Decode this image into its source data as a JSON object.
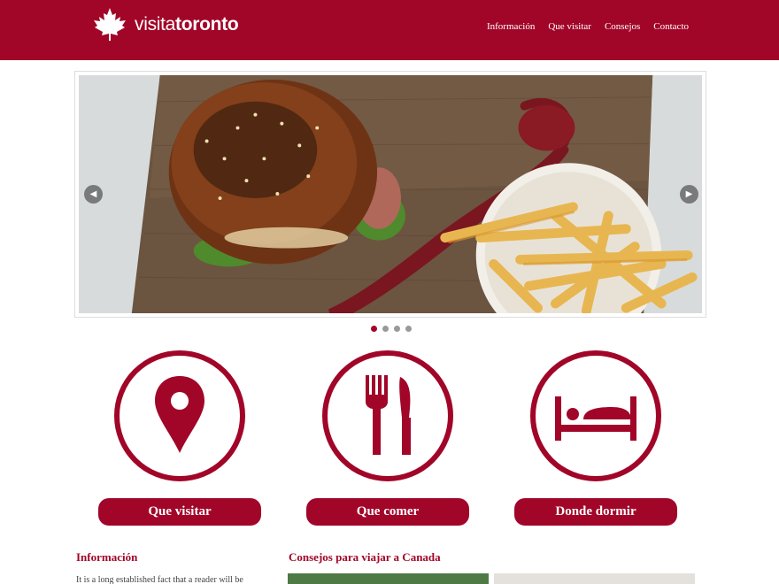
{
  "header": {
    "logo": {
      "light": "visita",
      "bold": "toronto"
    },
    "nav": [
      "Información",
      "Que visitar",
      "Consejos",
      "Contacto"
    ],
    "color": "#a10628"
  },
  "carousel": {
    "prev_icon": "chevron-left-icon",
    "next_icon": "chevron-right-icon",
    "slides": 4,
    "active_slide": 1
  },
  "features": [
    {
      "label": "Que visitar",
      "icon": "map-pin-icon"
    },
    {
      "label": "Que comer",
      "icon": "fork-knife-icon"
    },
    {
      "label": "Donde dormir",
      "icon": "bed-icon"
    }
  ],
  "info": {
    "title": "Información",
    "text": "It is a long established fact that a reader will be"
  },
  "tips": {
    "title": "Consejos para viajar a Canada"
  }
}
